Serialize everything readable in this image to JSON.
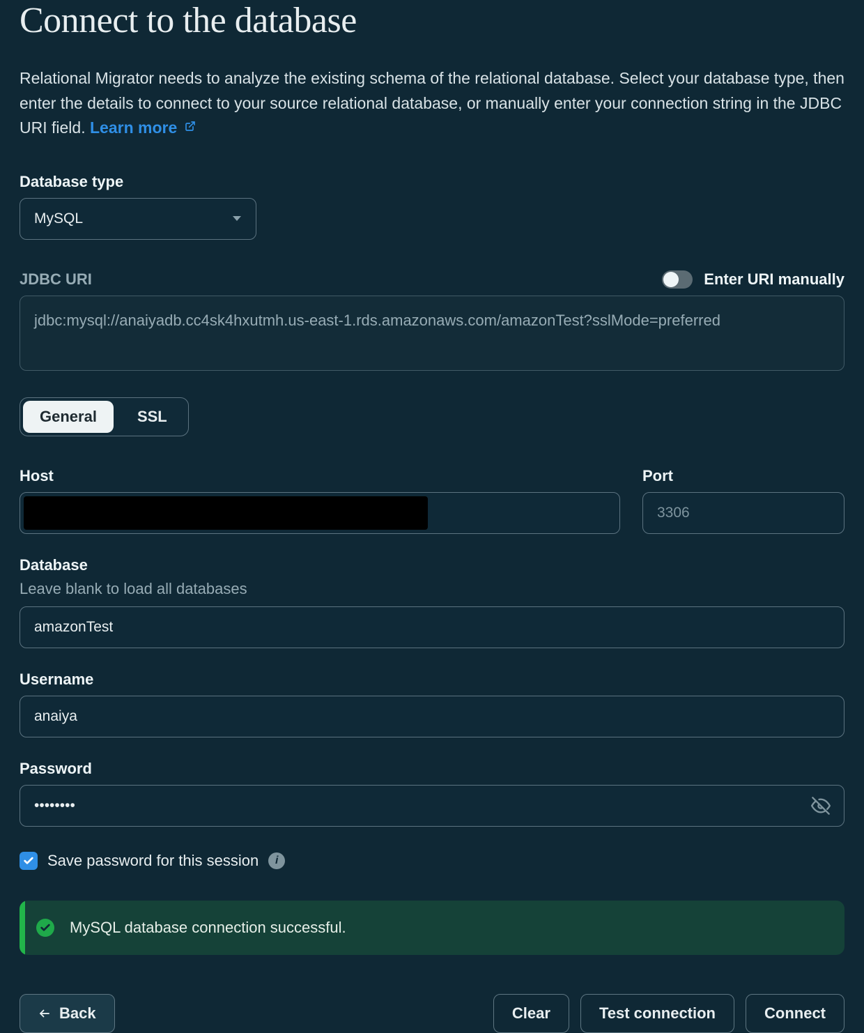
{
  "header": {
    "title": "Connect to the database",
    "description_prefix": "Relational Migrator needs to analyze the existing schema of the relational database. Select your database type, then enter the details to connect to your source relational database, or manually enter your connection string in the JDBC URI field. ",
    "learn_more": "Learn more"
  },
  "db_type": {
    "label": "Database type",
    "value": "MySQL"
  },
  "jdbc": {
    "label": "JDBC URI",
    "toggle_label": "Enter URI manually",
    "toggle_on": false,
    "value": "jdbc:mysql://anaiyadb.cc4sk4hxutmh.us-east-1.rds.amazonaws.com/amazonTest?sslMode=preferred"
  },
  "tabs": {
    "general": "General",
    "ssl": "SSL",
    "active": "general"
  },
  "fields": {
    "host_label": "Host",
    "host_value": "",
    "port_label": "Port",
    "port_placeholder": "3306",
    "port_value": "",
    "database_label": "Database",
    "database_hint": "Leave blank to load all databases",
    "database_value": "amazonTest",
    "username_label": "Username",
    "username_value": "anaiya",
    "password_label": "Password",
    "password_value": "••••••••"
  },
  "save_pw": {
    "checked": true,
    "label": "Save password for this session"
  },
  "banner": {
    "message": "MySQL database connection successful."
  },
  "buttons": {
    "back": "Back",
    "clear": "Clear",
    "test": "Test connection",
    "connect": "Connect"
  }
}
